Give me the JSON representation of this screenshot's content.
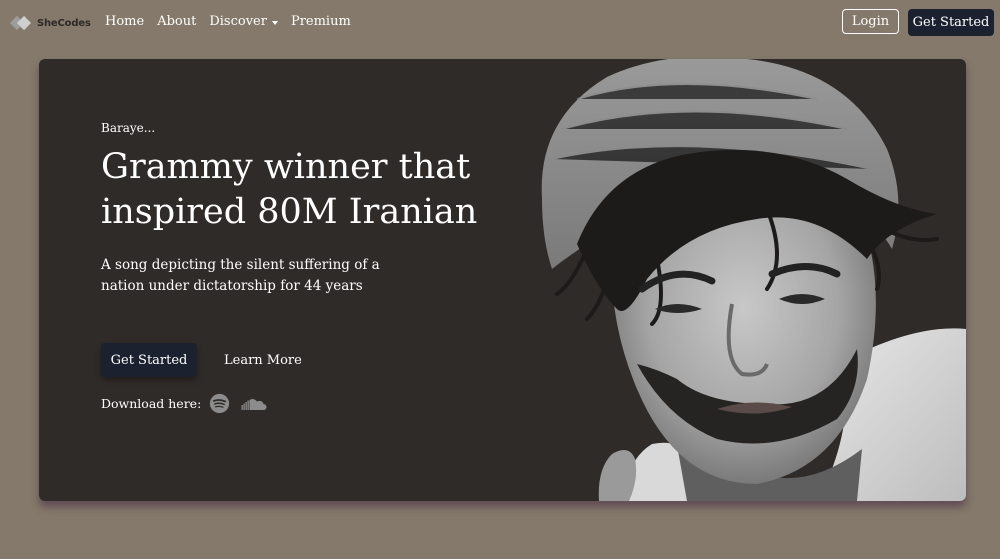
{
  "nav": {
    "brand": "SheCodes",
    "links": [
      {
        "label": "Home"
      },
      {
        "label": "About"
      },
      {
        "label": "Discover",
        "dropdown": true
      },
      {
        "label": "Premium"
      }
    ],
    "login_label": "Login",
    "get_started_label": "Get Started"
  },
  "hero": {
    "eyebrow": "Baraye...",
    "headline": "Grammy winner that inspired 80M Iranian",
    "subtext": "A song depicting the silent suffering of a nation under dictatorship for 44 years",
    "primary_button": "Get Started",
    "secondary_button": "Learn More",
    "download_label": "Download here:",
    "download_icons": [
      "spotify-icon",
      "soundcloud-icon"
    ]
  },
  "colors": {
    "page_background": "#84796a",
    "card_background": "#2f2b28",
    "button_dark": "#1c2130",
    "text": "#ffffff"
  }
}
